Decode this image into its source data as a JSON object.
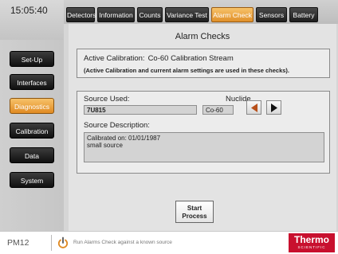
{
  "clock": "15:05:40",
  "tabs": [
    "Detectors",
    "Information",
    "Counts",
    "Variance Test",
    "Alarm Check",
    "Sensors",
    "Battery"
  ],
  "active_tab": "Alarm Check",
  "nav": [
    "Set-Up",
    "Interfaces",
    "Diagnostics",
    "Calibration",
    "Data",
    "System"
  ],
  "active_nav": "Diagnostics",
  "page_title": "Alarm Checks",
  "active_calibration": {
    "label": "Active Calibration:",
    "value": "Co-60 Calibration Stream",
    "note": "(Active Calibration and current alarm settings are used in these checks)."
  },
  "source": {
    "source_used_label": "Source Used:",
    "source_used_value": "7U815",
    "nuclide_label": "Nuclide",
    "nuclide_value": "Co-60",
    "description_label": "Source Description:",
    "description_line1": "Calibrated on: 01/01/1987",
    "description_line2": "small source"
  },
  "start_button": {
    "line1": "Start",
    "line2": "Process"
  },
  "footer": {
    "model": "PM12",
    "status": "Run Alarms Check against a known source",
    "logo_main": "Thermo",
    "logo_sub": "SCIENTIFIC"
  },
  "colors": {
    "accent": "#e8962e",
    "brand": "#c8102e",
    "button_dark": "#1a1a1a"
  },
  "icons": [
    "power-icon",
    "arrow-left-icon",
    "arrow-right-icon"
  ]
}
